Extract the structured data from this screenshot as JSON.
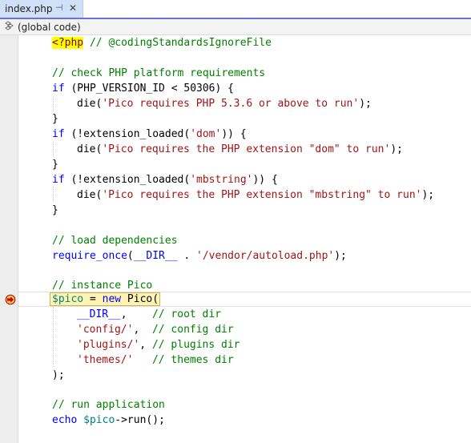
{
  "tab": {
    "title": "index.php",
    "pin_icon": "⊣",
    "close_icon": "✕"
  },
  "navbar": {
    "icon": "scope-icon",
    "label": "(global code)"
  },
  "colors": {
    "accent": "#6b72d4",
    "keyword": "#0000ff",
    "string": "#a31515",
    "comment": "#008000",
    "variable": "#008080",
    "current_statement_bg": "#fff4b3",
    "breakpoint_arrow": "#c4000c"
  },
  "code": {
    "l1": {
      "open_tag": "<?php",
      "comment": " // @codingStandardsIgnoreFile"
    },
    "l2": {
      "text": ""
    },
    "l3": {
      "comment": "// check PHP platform requirements"
    },
    "l4": {
      "kw": "if",
      "rest": " (PHP_VERSION_ID < 50306) {"
    },
    "l5": {
      "a": "die(",
      "str": "'Pico requires PHP 5.3.6 or above to run'",
      "b": ");"
    },
    "l6": {
      "text": "}"
    },
    "l7": {
      "kw": "if",
      "a": " (!extension_loaded(",
      "str": "'dom'",
      "b": ")) {"
    },
    "l8": {
      "a": "die(",
      "str": "'Pico requires the PHP extension \"dom\" to run'",
      "b": ");"
    },
    "l9": {
      "text": "}"
    },
    "l10": {
      "kw": "if",
      "a": " (!extension_loaded(",
      "str": "'mbstring'",
      "b": ")) {"
    },
    "l11": {
      "a": "die(",
      "str": "'Pico requires the PHP extension \"mbstring\" to run'",
      "b": ");"
    },
    "l12": {
      "text": "}"
    },
    "l13": {
      "text": ""
    },
    "l14": {
      "comment": "// load dependencies"
    },
    "l15": {
      "kw": "require_once",
      "a": "(",
      "kw2": "__DIR__",
      "b": " . ",
      "str": "'/vendor/autoload.php'",
      "c": ");"
    },
    "l16": {
      "text": ""
    },
    "l17": {
      "comment": "// instance Pico"
    },
    "l18": {
      "var": "$pico",
      "a": " = ",
      "kw": "new",
      "b": " Pico("
    },
    "l19": {
      "kw": "__DIR__",
      "a": ",    ",
      "comment": "// root dir"
    },
    "l20": {
      "str": "'config/'",
      "a": ",  ",
      "comment": "// config dir"
    },
    "l21": {
      "str": "'plugins/'",
      "a": ", ",
      "comment": "// plugins dir"
    },
    "l22": {
      "str": "'themes/'",
      "a": "   ",
      "comment": "// themes dir"
    },
    "l23": {
      "text": ");"
    },
    "l24": {
      "text": ""
    },
    "l25": {
      "comment": "// run application"
    },
    "l26": {
      "kw": "echo",
      "a": " ",
      "var": "$pico",
      "b": "->run();"
    }
  }
}
